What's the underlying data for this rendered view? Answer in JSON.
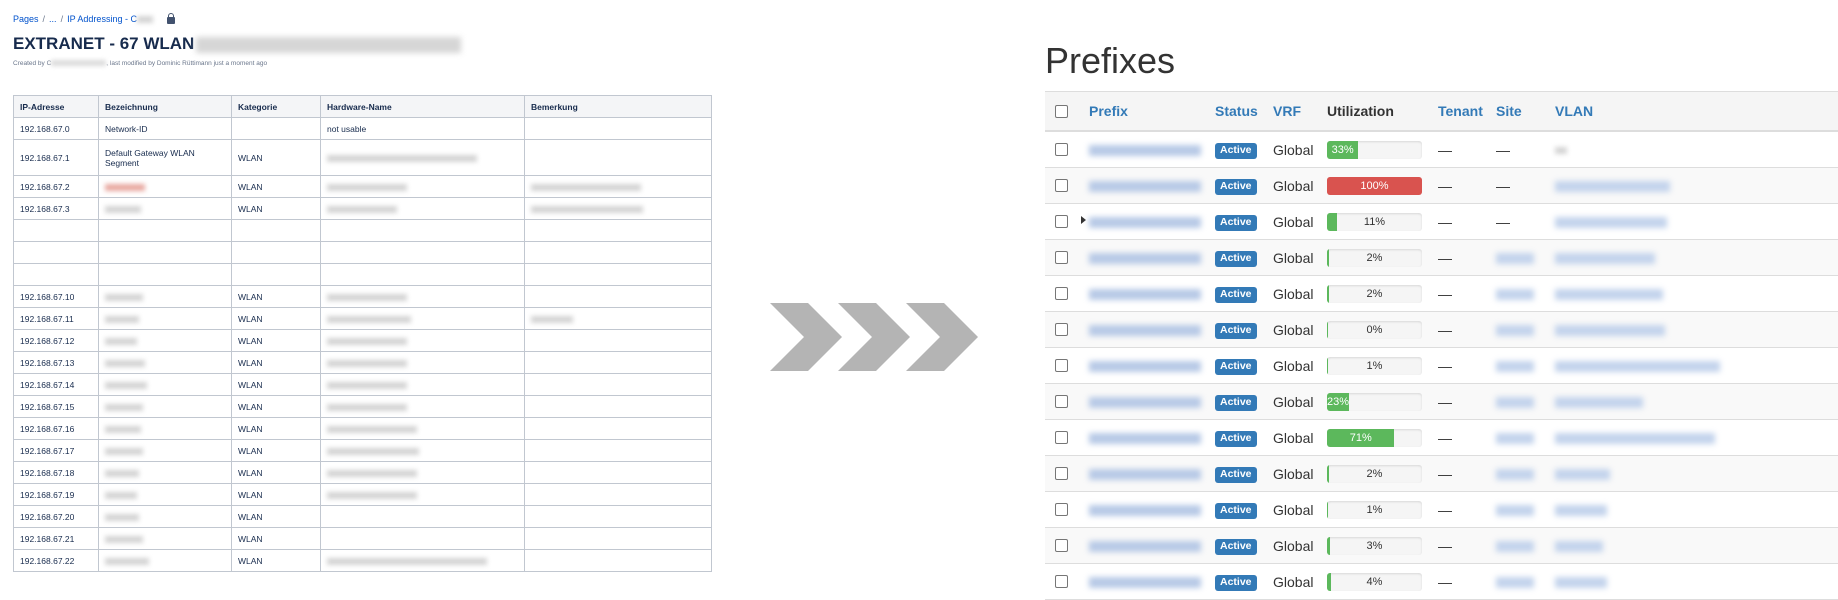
{
  "confluence": {
    "breadcrumbs": [
      "Pages",
      "/",
      "...",
      "/",
      "IP Addressing - C"
    ],
    "title": "EXTRANET - 67 WLAN",
    "byline": {
      "created_by": "Created by C",
      "modified": ", last modified by Dominic Rüttimann just a moment ago"
    },
    "columns": [
      "IP-Adresse",
      "Bezeichnung",
      "Kategorie",
      "Hardware-Name",
      "Bemerkung"
    ],
    "rows": [
      {
        "ip": "192.168.67.0",
        "bezeichnung": "Network-ID",
        "kategorie": "",
        "hardware": "not usable",
        "bemerkung": ""
      },
      {
        "ip": "192.168.67.1",
        "bezeichnung": "Default Gateway WLAN Segment",
        "kategorie": "WLAN",
        "hardware": "",
        "bemerkung": ""
      },
      {
        "ip": "192.168.67.2",
        "bezeichnung": "",
        "kategorie": "WLAN",
        "hardware": "",
        "bemerkung": ""
      },
      {
        "ip": "192.168.67.3",
        "bezeichnung": "",
        "kategorie": "WLAN",
        "hardware": "",
        "bemerkung": ""
      },
      {
        "ip": "",
        "bezeichnung": "",
        "kategorie": "",
        "hardware": "",
        "bemerkung": ""
      },
      {
        "ip": "",
        "bezeichnung": "",
        "kategorie": "",
        "hardware": "",
        "bemerkung": ""
      },
      {
        "ip": "",
        "bezeichnung": "",
        "kategorie": "",
        "hardware": "",
        "bemerkung": ""
      },
      {
        "ip": "192.168.67.10",
        "bezeichnung": "",
        "kategorie": "WLAN",
        "hardware": "",
        "bemerkung": ""
      },
      {
        "ip": "192.168.67.11",
        "bezeichnung": "",
        "kategorie": "WLAN",
        "hardware": "",
        "bemerkung": ""
      },
      {
        "ip": "192.168.67.12",
        "bezeichnung": "",
        "kategorie": "WLAN",
        "hardware": "",
        "bemerkung": ""
      },
      {
        "ip": "192.168.67.13",
        "bezeichnung": "",
        "kategorie": "WLAN",
        "hardware": "",
        "bemerkung": ""
      },
      {
        "ip": "192.168.67.14",
        "bezeichnung": "",
        "kategorie": "WLAN",
        "hardware": "",
        "bemerkung": ""
      },
      {
        "ip": "192.168.67.15",
        "bezeichnung": "",
        "kategorie": "WLAN",
        "hardware": "",
        "bemerkung": ""
      },
      {
        "ip": "192.168.67.16",
        "bezeichnung": "",
        "kategorie": "WLAN",
        "hardware": "",
        "bemerkung": ""
      },
      {
        "ip": "192.168.67.17",
        "bezeichnung": "",
        "kategorie": "WLAN",
        "hardware": "",
        "bemerkung": ""
      },
      {
        "ip": "192.168.67.18",
        "bezeichnung": "",
        "kategorie": "WLAN",
        "hardware": "",
        "bemerkung": ""
      },
      {
        "ip": "192.168.67.19",
        "bezeichnung": "",
        "kategorie": "WLAN",
        "hardware": "",
        "bemerkung": ""
      },
      {
        "ip": "192.168.67.20",
        "bezeichnung": "",
        "kategorie": "WLAN",
        "hardware": "",
        "bemerkung": ""
      },
      {
        "ip": "192.168.67.21",
        "bezeichnung": "",
        "kategorie": "WLAN",
        "hardware": "",
        "bemerkung": ""
      },
      {
        "ip": "192.168.67.22",
        "bezeichnung": "",
        "kategorie": "WLAN",
        "hardware": "",
        "bemerkung": ""
      }
    ]
  },
  "arrow_icon": "triple-chevron-right-icon",
  "netbox": {
    "title": "Prefixes",
    "columns": {
      "prefix": "Prefix",
      "status": "Status",
      "vrf": "VRF",
      "utilization": "Utilization",
      "tenant": "Tenant",
      "site": "Site",
      "vlan": "VLAN"
    },
    "rows": [
      {
        "status": "Active",
        "vrf": "Global",
        "util": 33,
        "util_label": "33%",
        "tenant": "—",
        "site": "—",
        "vlan": "—",
        "expand": false
      },
      {
        "status": "Active",
        "vrf": "Global",
        "util": 100,
        "util_label": "100%",
        "tenant": "—",
        "site": "—",
        "vlan": "",
        "expand": false
      },
      {
        "status": "Active",
        "vrf": "Global",
        "util": 11,
        "util_label": "11%",
        "tenant": "—",
        "site": "—",
        "vlan": "",
        "expand": true
      },
      {
        "status": "Active",
        "vrf": "Global",
        "util": 2,
        "util_label": "2%",
        "tenant": "—",
        "site": "",
        "vlan": "",
        "expand": false
      },
      {
        "status": "Active",
        "vrf": "Global",
        "util": 2,
        "util_label": "2%",
        "tenant": "—",
        "site": "",
        "vlan": "",
        "expand": false
      },
      {
        "status": "Active",
        "vrf": "Global",
        "util": 0,
        "util_label": "0%",
        "tenant": "—",
        "site": "",
        "vlan": "",
        "expand": false
      },
      {
        "status": "Active",
        "vrf": "Global",
        "util": 1,
        "util_label": "1%",
        "tenant": "—",
        "site": "",
        "vlan": "",
        "expand": false
      },
      {
        "status": "Active",
        "vrf": "Global",
        "util": 23,
        "util_label": "23%",
        "tenant": "—",
        "site": "",
        "vlan": "",
        "expand": false
      },
      {
        "status": "Active",
        "vrf": "Global",
        "util": 71,
        "util_label": "71%",
        "tenant": "—",
        "site": "",
        "vlan": "",
        "expand": false
      },
      {
        "status": "Active",
        "vrf": "Global",
        "util": 2,
        "util_label": "2%",
        "tenant": "—",
        "site": "",
        "vlan": "",
        "expand": false
      },
      {
        "status": "Active",
        "vrf": "Global",
        "util": 1,
        "util_label": "1%",
        "tenant": "—",
        "site": "",
        "vlan": "",
        "expand": false
      },
      {
        "status": "Active",
        "vrf": "Global",
        "util": 3,
        "util_label": "3%",
        "tenant": "—",
        "site": "",
        "vlan": "",
        "expand": false
      },
      {
        "status": "Active",
        "vrf": "Global",
        "util": 4,
        "util_label": "4%",
        "tenant": "—",
        "site": "",
        "vlan": "",
        "expand": false
      }
    ],
    "colors": {
      "link": "#337ab7",
      "bar_ok": "#5cb85c",
      "bar_full": "#d9534f",
      "badge": "#337ab7"
    }
  }
}
